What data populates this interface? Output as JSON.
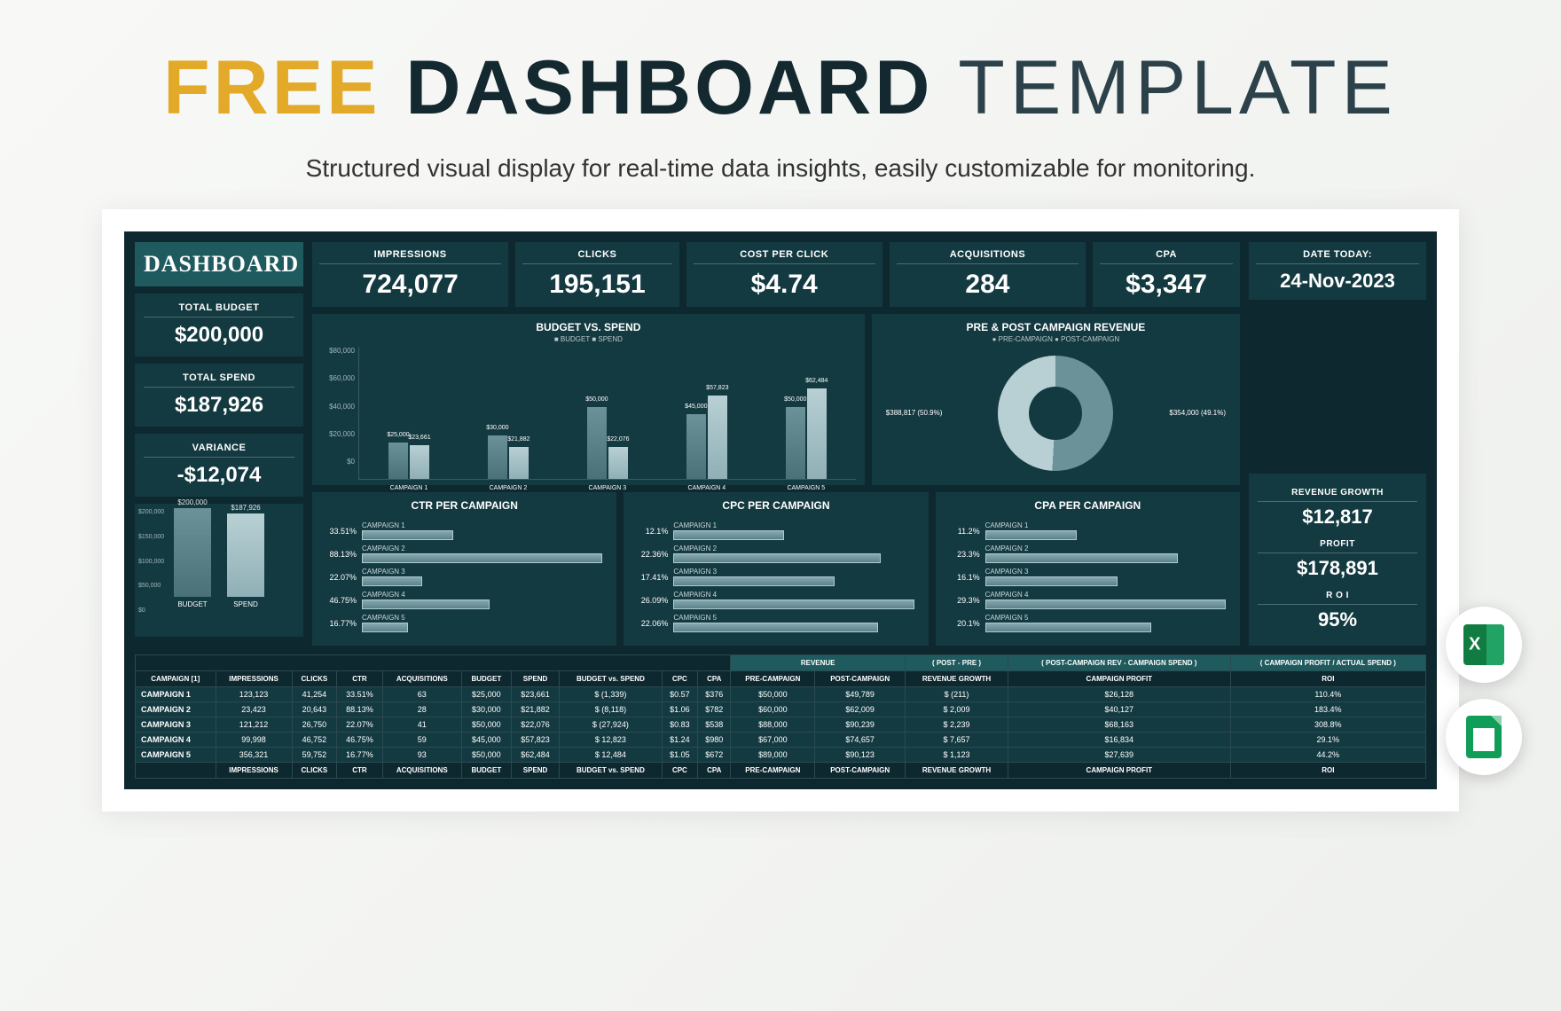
{
  "page": {
    "title_word1": "FREE",
    "title_word2": "DASHBOARD",
    "title_word3": "TEMPLATE",
    "subtitle": "Structured visual display for real-time data insights, easily customizable for monitoring."
  },
  "dashboard_title": "DASHBOARD",
  "left": {
    "budget_label": "TOTAL BUDGET",
    "budget": "$200,000",
    "spend_label": "TOTAL SPEND",
    "spend": "$187,926",
    "var_label": "VARIANCE",
    "var": "-$12,074"
  },
  "kpis": [
    {
      "label": "IMPRESSIONS",
      "value": "724,077"
    },
    {
      "label": "CLICKS",
      "value": "195,151"
    },
    {
      "label": "COST PER CLICK",
      "value": "$4.74"
    },
    {
      "label": "ACQUISITIONS",
      "value": "284"
    },
    {
      "label": "CPA",
      "value": "$3,347"
    }
  ],
  "date": {
    "label": "DATE TODAY:",
    "value": "24-Nov-2023"
  },
  "right": {
    "rg_label": "REVENUE GROWTH",
    "rg": "$12,817",
    "profit_label": "PROFIT",
    "profit": "$178,891",
    "roi_label": "R O I",
    "roi": "95%"
  },
  "chart_data": {
    "budget_vs_spend": {
      "type": "bar",
      "title": "BUDGET VS. SPEND",
      "legend": "■ BUDGET  ■ SPEND",
      "ylim": [
        0,
        80000
      ],
      "yticks": [
        "$80,000",
        "$60,000",
        "$40,000",
        "$20,000",
        "$0"
      ],
      "categories": [
        "CAMPAIGN 1",
        "CAMPAIGN 2",
        "CAMPAIGN 3",
        "CAMPAIGN 4",
        "CAMPAIGN 5"
      ],
      "series": [
        {
          "name": "BUDGET",
          "values": [
            25000,
            30000,
            50000,
            45000,
            50000
          ],
          "labels": [
            "$25,000",
            "$30,000",
            "$50,000",
            "$45,000",
            "$50,000"
          ]
        },
        {
          "name": "SPEND",
          "values": [
            23661,
            21882,
            22076,
            57823,
            62484
          ],
          "labels": [
            "$23,661",
            "$21,882",
            "$22,076",
            "$57,823",
            "$62,484"
          ]
        }
      ]
    },
    "pie": {
      "type": "donut",
      "title": "PRE & POST CAMPAIGN REVENUE",
      "legend": "● PRE-CAMPAIGN  ● POST-CAMPAIGN",
      "slices": [
        {
          "name": "PRE-CAMPAIGN",
          "value": 388817,
          "pct": 50.9,
          "label": "$388,817 (50.9%)"
        },
        {
          "name": "POST-CAMPAIGN",
          "value": 354000,
          "pct": 49.1,
          "label": "$354,000 (49.1%)"
        }
      ]
    },
    "mini_bar": {
      "type": "bar",
      "categories": [
        "BUDGET",
        "SPEND"
      ],
      "values": [
        200000,
        187926
      ],
      "labels": [
        "$200,000",
        "$187,926"
      ],
      "yticks": [
        "$200,000",
        "$150,000",
        "$100,000",
        "$50,000",
        "$0"
      ]
    },
    "ctr": {
      "type": "bar_horizontal",
      "title": "CTR PER CAMPAIGN",
      "items": [
        {
          "label": "CAMPAIGN 1",
          "pct": 33.51
        },
        {
          "label": "CAMPAIGN 2",
          "pct": 88.13
        },
        {
          "label": "CAMPAIGN 3",
          "pct": 22.07
        },
        {
          "label": "CAMPAIGN 4",
          "pct": 46.75
        },
        {
          "label": "CAMPAIGN 5",
          "pct": 16.77
        }
      ]
    },
    "cpc": {
      "type": "bar_horizontal",
      "title": "CPC PER CAMPAIGN",
      "items": [
        {
          "label": "CAMPAIGN 1",
          "pct": 12.1
        },
        {
          "label": "CAMPAIGN 2",
          "pct": 22.36
        },
        {
          "label": "CAMPAIGN 3",
          "pct": 17.41
        },
        {
          "label": "CAMPAIGN 4",
          "pct": 26.09
        },
        {
          "label": "CAMPAIGN 5",
          "pct": 22.06
        }
      ]
    },
    "cpa": {
      "type": "bar_horizontal",
      "title": "CPA PER CAMPAIGN",
      "items": [
        {
          "label": "CAMPAIGN 1",
          "pct": 11.2
        },
        {
          "label": "CAMPAIGN 2",
          "pct": 23.3
        },
        {
          "label": "CAMPAIGN 3",
          "pct": 16.1
        },
        {
          "label": "CAMPAIGN 4",
          "pct": 29.3
        },
        {
          "label": "CAMPAIGN 5",
          "pct": 20.1
        }
      ]
    }
  },
  "table": {
    "group_headers": {
      "revenue": "REVENUE",
      "postpre": "( POST - PRE )",
      "profit_col": "( POST-CAMPAIGN REV - CAMPAIGN SPEND )",
      "roi_col": "( CAMPAIGN PROFIT / ACTUAL SPEND )"
    },
    "headers": [
      "CAMPAIGN [1]",
      "IMPRESSIONS",
      "CLICKS",
      "CTR",
      "ACQUISITIONS",
      "BUDGET",
      "SPEND",
      "BUDGET vs. SPEND",
      "CPC",
      "CPA",
      "PRE-CAMPAIGN",
      "POST-CAMPAIGN",
      "REVENUE GROWTH",
      "CAMPAIGN PROFIT",
      "ROI"
    ],
    "rows": [
      [
        "CAMPAIGN 1",
        "123,123",
        "41,254",
        "33.51%",
        "63",
        "$25,000",
        "$23,661",
        "$   (1,339)",
        "$0.57",
        "$376",
        "$50,000",
        "$49,789",
        "$      (211)",
        "$26,128",
        "110.4%"
      ],
      [
        "CAMPAIGN 2",
        "23,423",
        "20,643",
        "88.13%",
        "28",
        "$30,000",
        "$21,882",
        "$   (8,118)",
        "$1.06",
        "$782",
        "$60,000",
        "$62,009",
        "$   2,009",
        "$40,127",
        "183.4%"
      ],
      [
        "CAMPAIGN 3",
        "121,212",
        "26,750",
        "22.07%",
        "41",
        "$50,000",
        "$22,076",
        "$  (27,924)",
        "$0.83",
        "$538",
        "$88,000",
        "$90,239",
        "$   2,239",
        "$68,163",
        "308.8%"
      ],
      [
        "CAMPAIGN 4",
        "99,998",
        "46,752",
        "46.75%",
        "59",
        "$45,000",
        "$57,823",
        "$   12,823",
        "$1.24",
        "$980",
        "$67,000",
        "$74,657",
        "$   7,657",
        "$16,834",
        "29.1%"
      ],
      [
        "CAMPAIGN 5",
        "356,321",
        "59,752",
        "16.77%",
        "93",
        "$50,000",
        "$62,484",
        "$   12,484",
        "$1.05",
        "$672",
        "$89,000",
        "$90,123",
        "$   1,123",
        "$27,639",
        "44.2%"
      ]
    ],
    "footer": [
      "",
      "IMPRESSIONS",
      "CLICKS",
      "CTR",
      "ACQUISITIONS",
      "BUDGET",
      "SPEND",
      "BUDGET vs. SPEND",
      "CPC",
      "CPA",
      "PRE-CAMPAIGN",
      "POST-CAMPAIGN",
      "REVENUE GROWTH",
      "CAMPAIGN PROFIT",
      "ROI"
    ]
  }
}
